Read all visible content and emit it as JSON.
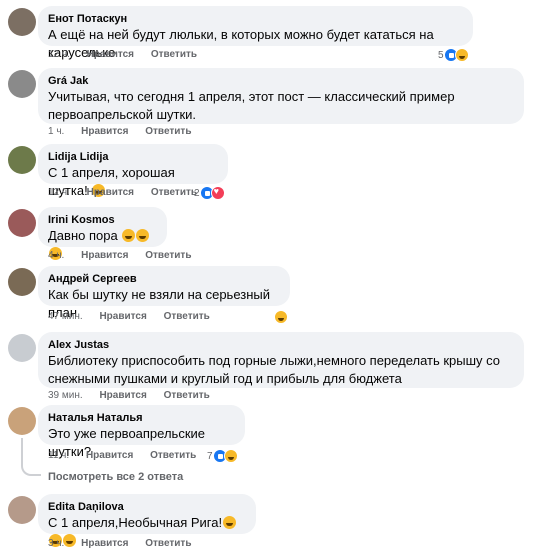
{
  "comments": [
    {
      "author": "Енот Потаскун",
      "text": "А ещё на ней будут люльки, в которых можно будет кататься на карусельке",
      "time": "12 ч.",
      "like": "Нравится",
      "reply": "Ответить",
      "react_count": "5",
      "avatar_color": "#7c6f63"
    },
    {
      "author": "Grá Jak",
      "text": "Учитывая, что сегодня 1 апреля, этот пост — классический пример первоапрельской шутки.",
      "time": "1 ч.",
      "like": "Нравится",
      "reply": "Ответить",
      "react_count": "",
      "avatar_color": "#8a8a8a"
    },
    {
      "author": "Lidija Lidija",
      "text": "С 1 апреля, хорошая шутка!",
      "time": "12 ч.",
      "like": "Нравится",
      "reply": "Ответить",
      "react_count": "2",
      "avatar_color": "#6d7a4a"
    },
    {
      "author": "Irini Kosmos",
      "text": "Давно пора",
      "time": "4 ч.",
      "like": "Нравится",
      "reply": "Ответить",
      "react_count": "",
      "avatar_color": "#9a5a5a"
    },
    {
      "author": "Андрей Сергеев",
      "text": "Как бы шутку не взяли на серьезный план",
      "time": "47 мин.",
      "like": "Нравится",
      "reply": "Ответить",
      "react_count": "",
      "avatar_color": "#7a6a55"
    },
    {
      "author": "Alex Justas",
      "text": "Библиотеку приспособить под горные лыжи,немного переделать крышу со снежными пушками и круглый год и прибыль для бюджета",
      "time": "39 мин.",
      "like": "Нравится",
      "reply": "Ответить",
      "react_count": "",
      "avatar_color": "#c8ccd1"
    },
    {
      "author": "Наталья Наталья",
      "text": "Это уже первоапрельские шутки?",
      "time": "11 ч.",
      "like": "Нравится",
      "reply": "Ответить",
      "react_count": "7",
      "avatar_color": "#c9a27a"
    },
    {
      "author": "Edita Daņilova",
      "text": "С 1 апреля,Необычная Рига!",
      "time": "3 ч.",
      "like": "Нравится",
      "reply": "Ответить",
      "react_count": "",
      "avatar_color": "#b59a8a"
    }
  ],
  "view_replies": "Посмотреть все 2 ответа"
}
